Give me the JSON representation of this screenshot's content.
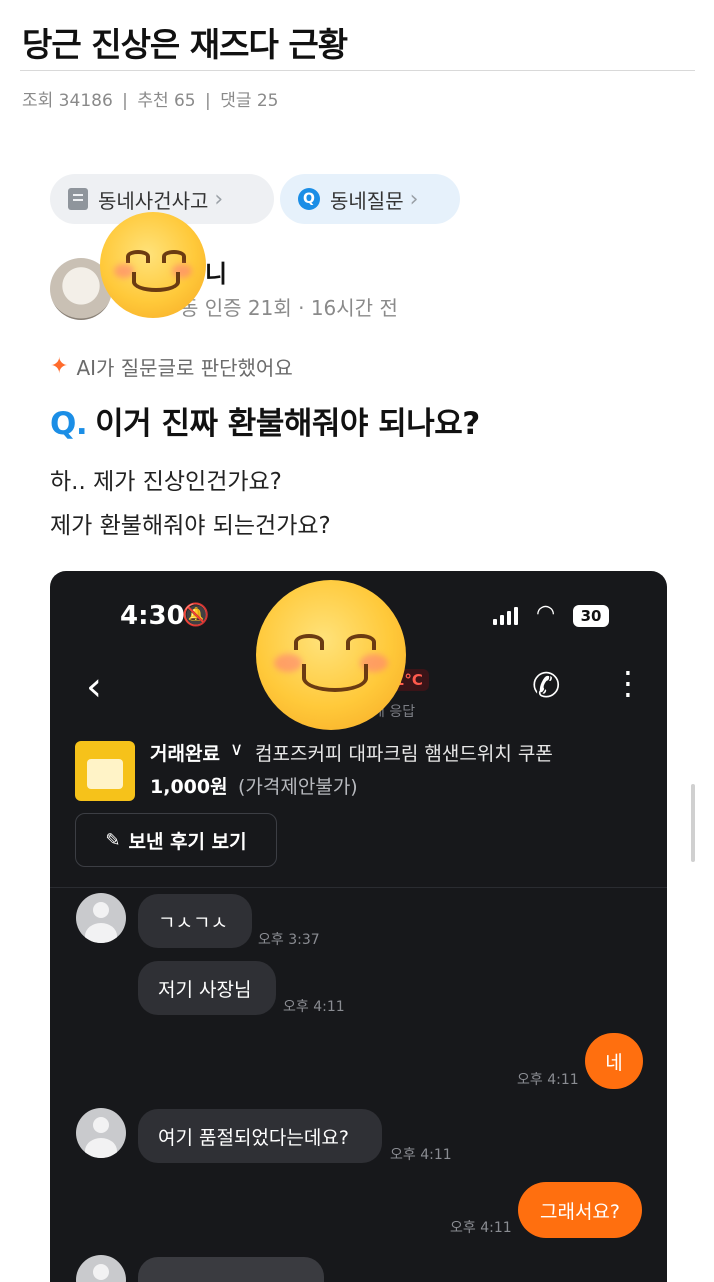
{
  "post": {
    "title": "당근 진상은 재즈다 근황",
    "views_label": "조회 34186",
    "recommend_label": "추천 65",
    "comments_label": "댓글 25",
    "separator": "|"
  },
  "screenshot": {
    "chips": [
      {
        "label": "동네사건사고",
        "arrow": "›"
      },
      {
        "label": "동네질문",
        "arrow": "›"
      }
    ],
    "user": {
      "name_visible": "니",
      "sub_visible": "동 인증 21회 · 16시간 전"
    },
    "ai_badge": "AI가 질문글로 판단했어요",
    "question_prefix": "Q.",
    "question": "이거 진짜 환불해줘야 되나요?",
    "body_lines": [
      "하.. 제가 진상인건가요?",
      "제가 환불해줘야 되는건가요?"
    ]
  },
  "phone": {
    "status_time": "4:30",
    "battery": "30",
    "temperature_visible": "1°C",
    "response_visible": "게 응답",
    "trade_status": "거래완료",
    "product": "컴포즈커피 대파크림 햄샌드위치 쿠폰",
    "price": "1,000원",
    "negotiation": "(가격제안불가)",
    "review_button": "보낸 후기 보기",
    "messages": [
      {
        "text": "ㄱㅅㄱㅅ",
        "time": "오후 3:37",
        "from": "other"
      },
      {
        "text": "저기 사장님",
        "time": "오후 4:11",
        "from": "other"
      },
      {
        "text": "네",
        "time": "오후 4:11",
        "from": "me"
      },
      {
        "text": "여기 품절되었다는데요?",
        "time": "오후 4:11",
        "from": "other"
      },
      {
        "text": "그래서요?",
        "time": "오후 4:11",
        "from": "me"
      }
    ]
  },
  "colors": {
    "accent_blue": "#1b8ee6",
    "orange": "#ff6f0f",
    "phone_bg": "#17181b"
  },
  "icons": [
    "doc-icon",
    "q-badge-icon",
    "sparkle-icon",
    "bell-off-icon",
    "wifi-icon",
    "back-arrow-icon",
    "phone-call-icon",
    "more-vert-icon",
    "pencil-icon",
    "smiley-emoji-icon"
  ]
}
